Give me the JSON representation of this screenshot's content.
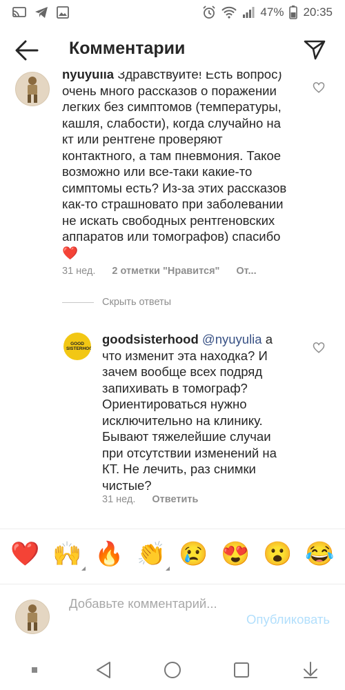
{
  "status_bar": {
    "battery": "47%",
    "time": "20:35",
    "icons": [
      "cast-icon",
      "telegram-icon",
      "image-icon",
      "alarm-icon",
      "wifi-icon",
      "signal-icon",
      "battery-icon"
    ]
  },
  "header": {
    "title": "Комментарии",
    "back_icon": "arrow-left-icon",
    "send_icon": "direct-send-icon"
  },
  "comments": [
    {
      "username": "nyuyulia",
      "text": "Здравствуйте! Есть вопрос) очень много рассказов о поражении легких без симптомов (температуры, кашля, слабости), когда случайно на кт или рентгене проверяют контактного, а там пневмония. Такое возможно или все-таки какие-то симптомы есть? Из-за этих рассказов как-то страшновато при заболевании не искать свободных рентгеновских аппаратов или томографов) спасибо",
      "emoji": "❤️",
      "time": "31 нед.",
      "likes": "2 отметки \"Нравится\"",
      "reply_label": "От..."
    }
  ],
  "hide_replies_label": "Скрыть ответы",
  "reply": {
    "username": "goodsisterhood",
    "mention": "@nyuyulia",
    "text": "а что изменит эта находка? И зачем вообще всех подряд запихивать в томограф? Ориентироваться нужно исключительно на клинику. Бывают тяжелейшие случаи при отсутствии изменений на КТ. Не лечить, раз снимки чистые?",
    "avatar_text": "GOOD SISTERHOOD",
    "time": "31 нед.",
    "reply_label": "Ответить"
  },
  "emoji_bar": [
    {
      "char": "❤️",
      "name": "red-heart",
      "more": false
    },
    {
      "char": "🙌",
      "name": "raising-hands",
      "more": true
    },
    {
      "char": "🔥",
      "name": "fire",
      "more": false
    },
    {
      "char": "👏",
      "name": "clapping-hands",
      "more": true
    },
    {
      "char": "😢",
      "name": "crying-face",
      "more": false
    },
    {
      "char": "😍",
      "name": "heart-eyes",
      "more": false
    },
    {
      "char": "😮",
      "name": "surprised-face",
      "more": false
    },
    {
      "char": "😂",
      "name": "tears-of-joy",
      "more": false
    }
  ],
  "composer": {
    "placeholder": "Добавьте комментарий...",
    "publish_label": "Опубликовать"
  },
  "colors": {
    "text": "#262626",
    "secondary": "#8e8e8e",
    "link": "#385185",
    "publish_disabled": "#b2dffc",
    "reply_avatar_bg": "#f2c714"
  }
}
